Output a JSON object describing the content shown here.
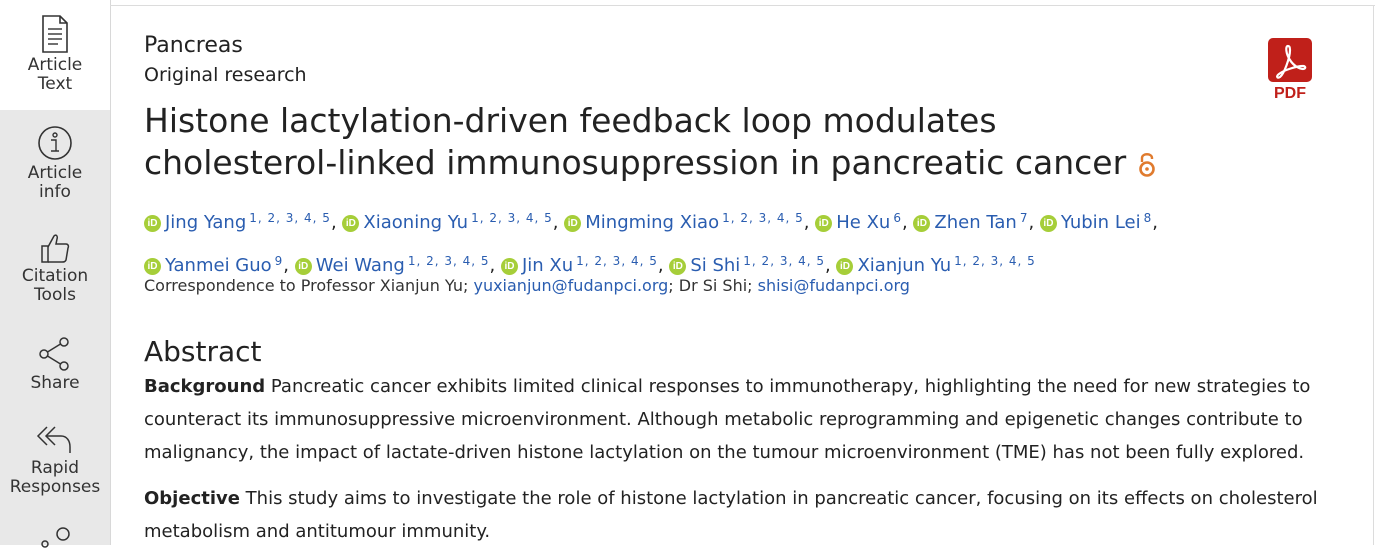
{
  "sidebar": {
    "items": [
      {
        "label": "Article\nText",
        "icon": "document-icon"
      },
      {
        "label": "Article\ninfo",
        "icon": "info-icon"
      },
      {
        "label": "Citation\nTools",
        "icon": "thumbs-up-icon"
      },
      {
        "label": "Share",
        "icon": "share-icon"
      },
      {
        "label": "Rapid\nResponses",
        "icon": "reply-all-icon"
      }
    ]
  },
  "article": {
    "section": "Pancreas",
    "type": "Original research",
    "title": "Histone lactylation-driven feedback loop modulates cholesterol-linked immunosuppression in pancreatic cancer",
    "pdf_label": "PDF",
    "authors": [
      {
        "name": "Jing Yang",
        "aff": "1, 2, 3, 4, 5"
      },
      {
        "name": "Xiaoning Yu",
        "aff": "1, 2, 3, 4, 5"
      },
      {
        "name": "Mingming Xiao",
        "aff": "1, 2, 3, 4, 5"
      },
      {
        "name": "He Xu",
        "aff": "6"
      },
      {
        "name": "Zhen Tan",
        "aff": "7"
      },
      {
        "name": "Yubin Lei",
        "aff": "8"
      },
      {
        "name": "Yanmei Guo",
        "aff": "9"
      },
      {
        "name": "Wei Wang",
        "aff": "1, 2, 3, 4, 5"
      },
      {
        "name": "Jin Xu",
        "aff": "1, 2, 3, 4, 5"
      },
      {
        "name": "Si Shi",
        "aff": "1, 2, 3, 4, 5"
      },
      {
        "name": "Xianjun Yu",
        "aff": "1, 2, 3, 4, 5"
      }
    ],
    "correspondence": {
      "prefix": "Correspondence to Professor Xianjun Yu; ",
      "email1": "yuxianjun@fudanpci.org",
      "middle": "; Dr Si Shi; ",
      "email2": "shisi@fudanpci.org"
    },
    "abstract": {
      "heading": "Abstract",
      "background_label": "Background",
      "background_text": " Pancreatic cancer exhibits limited clinical responses to immunotherapy, highlighting the need for new strategies to counteract its immunosuppressive microenvironment. Although metabolic reprogramming and epigenetic changes contribute to malignancy, the impact of lactate-driven histone lactylation on the tumour microenvironment (TME) has not been fully explored.",
      "objective_label": "Objective",
      "objective_text": " This study aims to investigate the role of histone lactylation in pancreatic cancer, focusing on its effects on cholesterol metabolism and antitumour immunity."
    }
  },
  "colors": {
    "link": "#2a5db0",
    "orcid": "#a6ce39",
    "pdf": "#c0201a",
    "open_access": "#e07b2e",
    "sidebar_bg": "#e8e8e8"
  }
}
